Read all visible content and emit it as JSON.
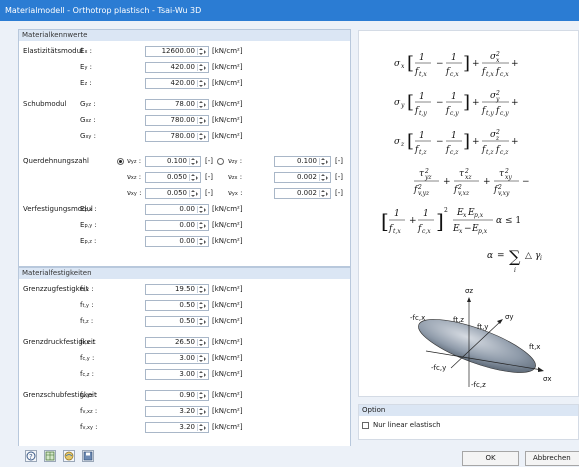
{
  "window": {
    "title": "Materialmodell - Orthotrop plastisch - Tsai-Wu 3D"
  },
  "groups": {
    "kennwerte": "Materialkennwerte",
    "festigkeiten": "Materialfestigkeiten"
  },
  "kennwerte": {
    "elastizitaet_label": "Elastizitätsmodul",
    "schub_label": "Schubmodul",
    "querdehnung_label": "Querdehnungszahl",
    "verfestigung_label": "Verfestigungsmodul",
    "E": [
      {
        "sym": "E",
        "sub": "x",
        "value": "12600.00",
        "unit": "[kN/cm²]"
      },
      {
        "sym": "E",
        "sub": "y",
        "value": "420.00",
        "unit": "[kN/cm²]"
      },
      {
        "sym": "E",
        "sub": "z",
        "value": "420.00",
        "unit": "[kN/cm²]"
      }
    ],
    "G": [
      {
        "sym": "G",
        "sub": "yz",
        "value": "78.00",
        "unit": "[kN/cm²]"
      },
      {
        "sym": "G",
        "sub": "xz",
        "value": "780.00",
        "unit": "[kN/cm²]"
      },
      {
        "sym": "G",
        "sub": "xy",
        "value": "780.00",
        "unit": "[kN/cm²]"
      }
    ],
    "nu_left": [
      {
        "sym": "ν",
        "sub": "yz",
        "value": "0.100",
        "unit": "[-]"
      },
      {
        "sym": "ν",
        "sub": "xz",
        "value": "0.050",
        "unit": "[-]"
      },
      {
        "sym": "ν",
        "sub": "xy",
        "value": "0.050",
        "unit": "[-]"
      }
    ],
    "nu_right": [
      {
        "sym": "ν",
        "sub": "zy",
        "value": "0.100",
        "unit": "[-]"
      },
      {
        "sym": "ν",
        "sub": "zx",
        "value": "0.002",
        "unit": "[-]"
      },
      {
        "sym": "ν",
        "sub": "yx",
        "value": "0.002",
        "unit": "[-]"
      }
    ],
    "Ep": [
      {
        "sym": "E",
        "sub": "p,x",
        "value": "0.00",
        "unit": "[kN/cm²]"
      },
      {
        "sym": "E",
        "sub": "p,y",
        "value": "0.00",
        "unit": "[kN/cm²]"
      },
      {
        "sym": "E",
        "sub": "p,z",
        "value": "0.00",
        "unit": "[kN/cm²]"
      }
    ]
  },
  "festigkeiten": {
    "zug_label": "Grenzzugfestigkeit",
    "druck_label": "Grenzdruckfestigkeit",
    "schub_label": "Grenzschubfestigkeit",
    "ft": [
      {
        "sym": "f",
        "sub": "t,x",
        "value": "19.50",
        "unit": "[kN/cm²]"
      },
      {
        "sym": "f",
        "sub": "t,y",
        "value": "0.50",
        "unit": "[kN/cm²]"
      },
      {
        "sym": "f",
        "sub": "t,z",
        "value": "0.50",
        "unit": "[kN/cm²]"
      }
    ],
    "fc": [
      {
        "sym": "f",
        "sub": "c,x",
        "value": "26.50",
        "unit": "[kN/cm²]"
      },
      {
        "sym": "f",
        "sub": "c,y",
        "value": "3.00",
        "unit": "[kN/cm²]"
      },
      {
        "sym": "f",
        "sub": "c,z",
        "value": "3.00",
        "unit": "[kN/cm²]"
      }
    ],
    "fv": [
      {
        "sym": "f",
        "sub": "v,yz",
        "value": "0.90",
        "unit": "[kN/cm²]"
      },
      {
        "sym": "f",
        "sub": "v,xz",
        "value": "3.20",
        "unit": "[kN/cm²]"
      },
      {
        "sym": "f",
        "sub": "v,xy",
        "value": "3.20",
        "unit": "[kN/cm²]"
      }
    ]
  },
  "diagram": {
    "labels": {
      "sz": "σz",
      "sy": "σy",
      "sx": "σx",
      "ftz": "ft,z",
      "fty": "ft,y",
      "ftx": "ft,x",
      "fcx": "-fc,x",
      "fcy": "-fc,y",
      "fcz": "-fc,z"
    }
  },
  "option": {
    "header": "Option",
    "checkbox_label": "Nur linear elastisch",
    "checked": false
  },
  "buttons": {
    "ok": "OK",
    "cancel": "Abbrechen"
  },
  "icons": [
    "help-icon",
    "table-icon",
    "globe-icon",
    "save-icon"
  ]
}
